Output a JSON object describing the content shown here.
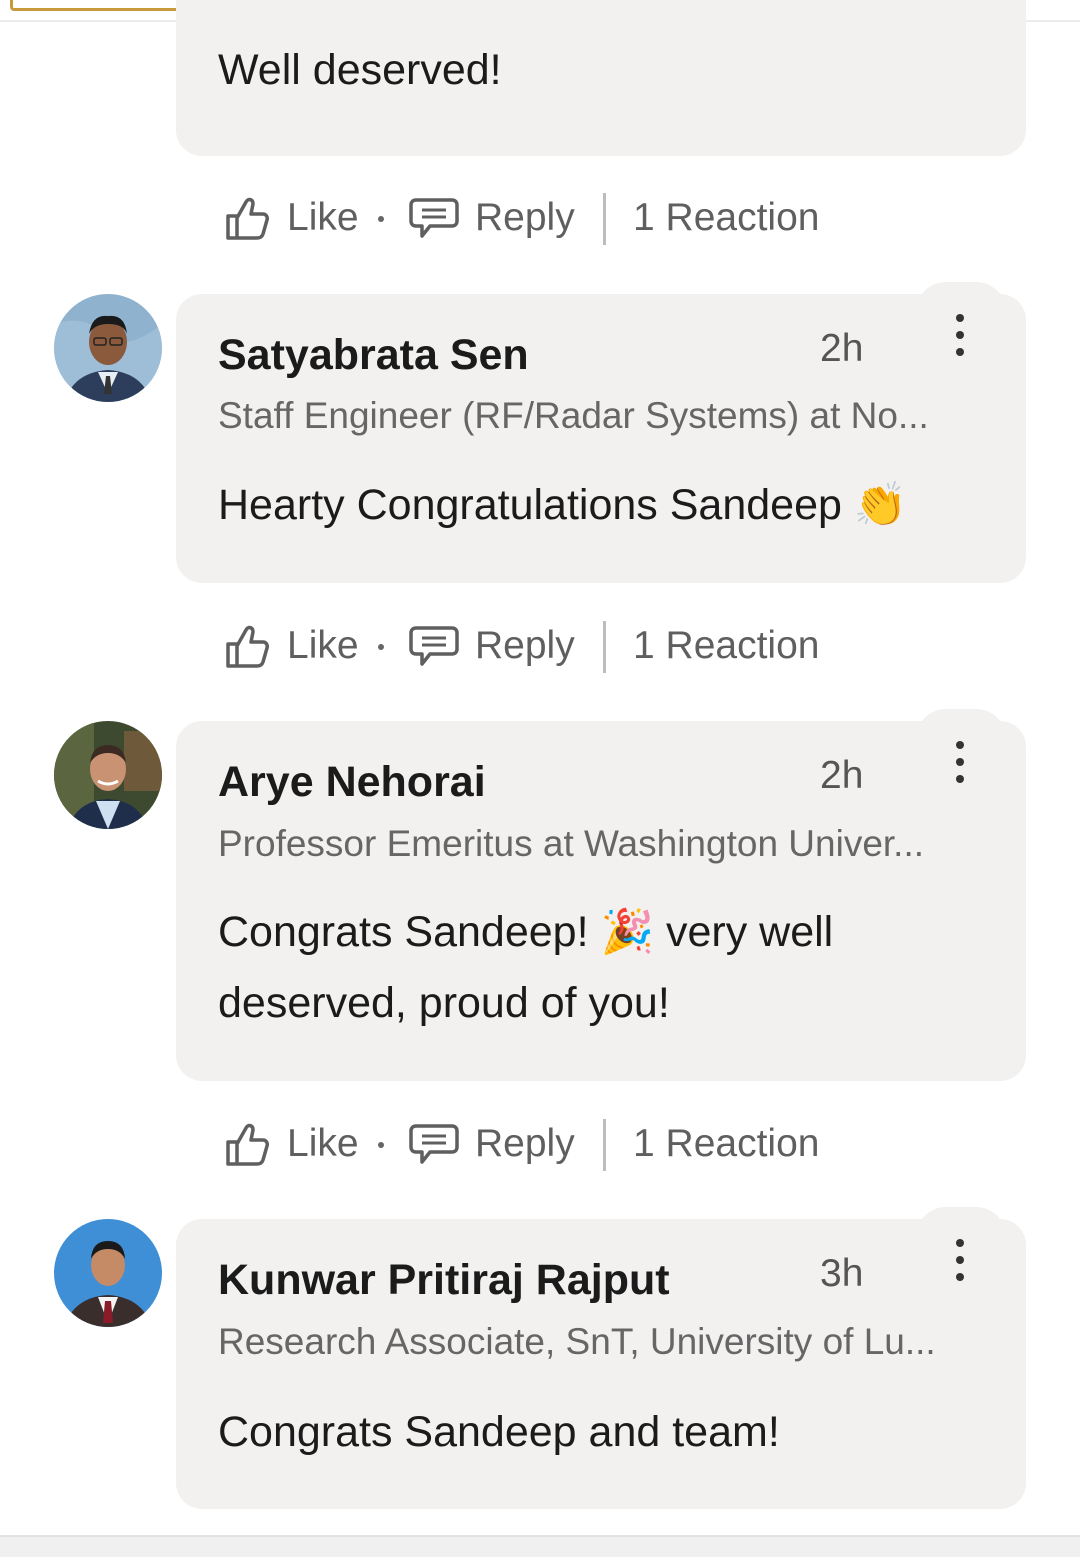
{
  "first_comment": {
    "text": "Well deserved!"
  },
  "actions": {
    "like": "Like",
    "reply": "Reply",
    "reactions": "1 Reaction"
  },
  "comments": [
    {
      "name": "Satyabrata Sen",
      "time": "2h",
      "headline": "Staff Engineer (RF/Radar Systems) at No...",
      "text_lines": [
        "Hearty Congratulations Sandeep 👏"
      ]
    },
    {
      "name": "Arye Nehorai",
      "time": "2h",
      "headline": "Professor Emeritus at Washington Univer...",
      "text_lines": [
        "Congrats Sandeep! 🎉 very well",
        "deserved, proud of you!"
      ]
    },
    {
      "name": "Kunwar Pritiraj Rajput",
      "time": "3h",
      "headline": "Research Associate, SnT, University of Lu...",
      "text_lines": [
        "Congrats Sandeep and team!"
      ]
    }
  ]
}
